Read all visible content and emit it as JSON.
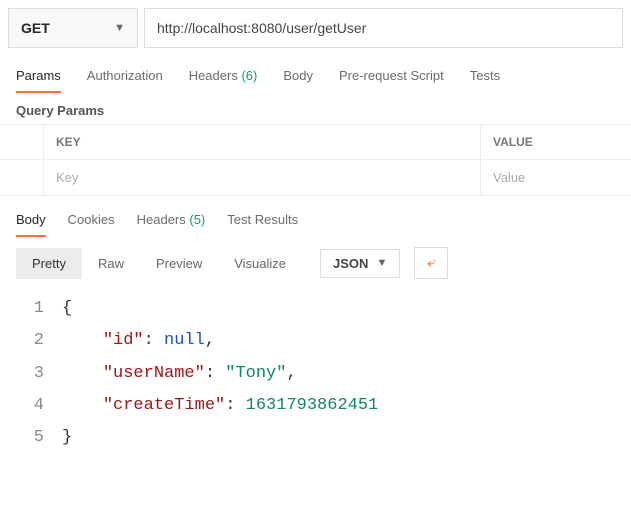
{
  "method": "GET",
  "url": "http://localhost:8080/user/getUser",
  "request_tabs": {
    "active_index": 0,
    "items": [
      {
        "label": "Params",
        "badge": ""
      },
      {
        "label": "Authorization",
        "badge": ""
      },
      {
        "label": "Headers",
        "badge": "(6)"
      },
      {
        "label": "Body",
        "badge": ""
      },
      {
        "label": "Pre-request Script",
        "badge": ""
      },
      {
        "label": "Tests",
        "badge": ""
      }
    ]
  },
  "query_params": {
    "section_label": "Query Params",
    "cols": {
      "key": "KEY",
      "value": "VALUE"
    },
    "placeholders": {
      "key": "Key",
      "value": "Value"
    }
  },
  "response_tabs": {
    "active_index": 0,
    "items": [
      {
        "label": "Body",
        "badge": ""
      },
      {
        "label": "Cookies",
        "badge": ""
      },
      {
        "label": "Headers",
        "badge": "(5)"
      },
      {
        "label": "Test Results",
        "badge": ""
      }
    ]
  },
  "view_modes": {
    "active_index": 0,
    "items": [
      "Pretty",
      "Raw",
      "Preview",
      "Visualize"
    ]
  },
  "body_type": "JSON",
  "response_json": {
    "id": null,
    "userName": "Tony",
    "createTime": 1631793862451
  }
}
